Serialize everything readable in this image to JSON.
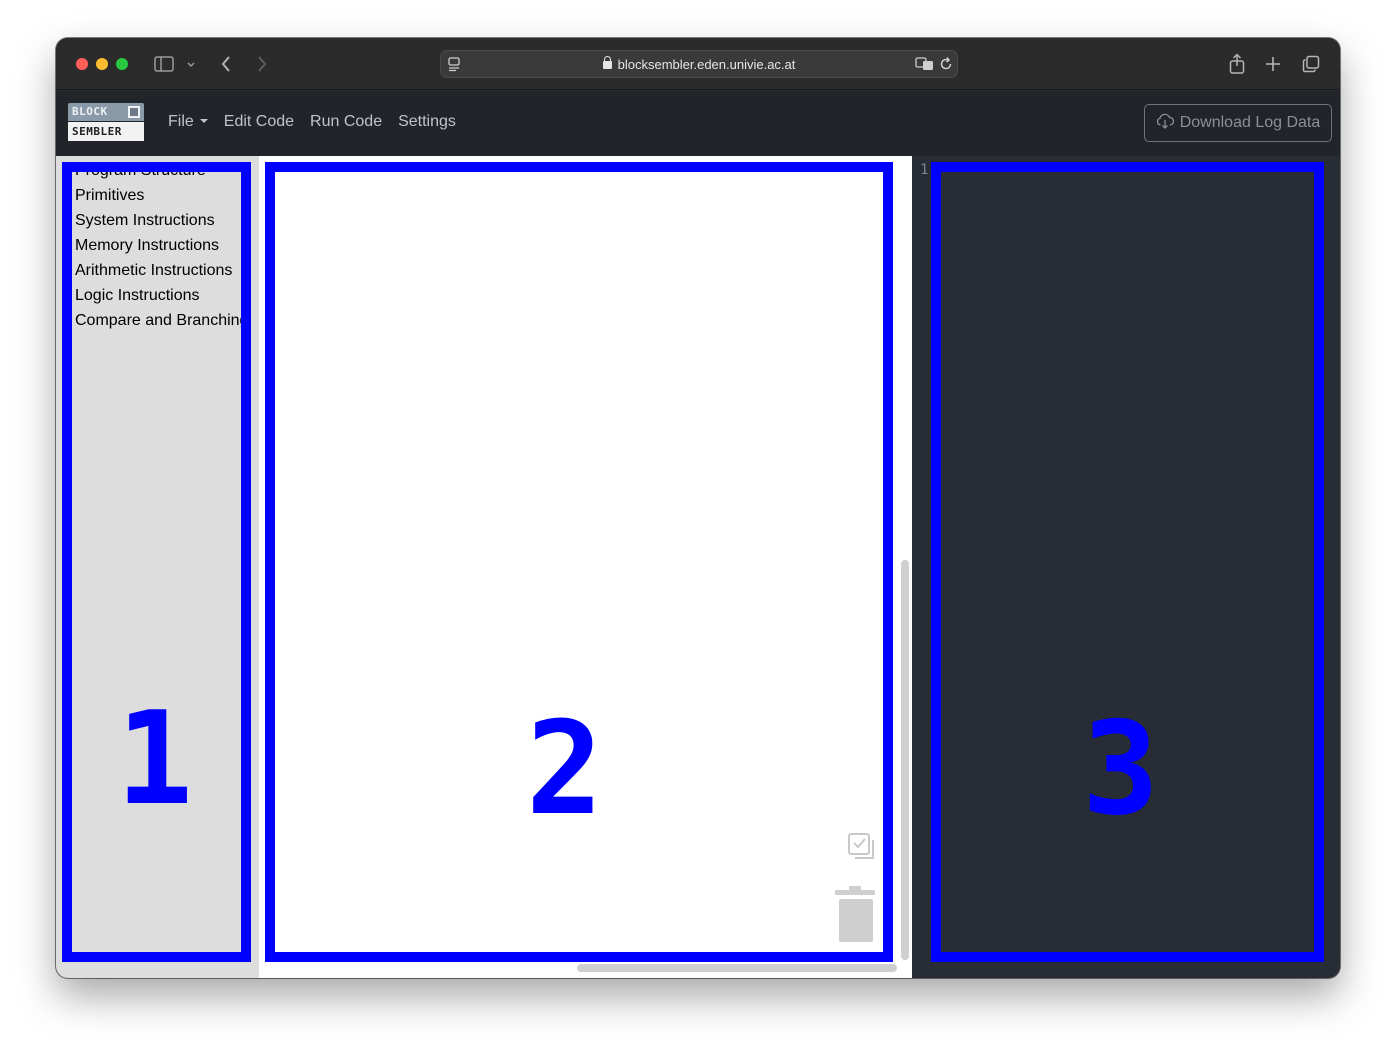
{
  "browser": {
    "url": "blocksembler.eden.univie.ac.at",
    "icons": [
      "sidebar-icon",
      "chevron-down-icon",
      "back-icon",
      "forward-icon",
      "page-settings-icon",
      "lock-icon",
      "translate-icon",
      "reload-icon",
      "share-icon",
      "plus-icon",
      "tabs-icon"
    ]
  },
  "app": {
    "logo": {
      "top": "BLOCK",
      "bottom": "SEMBLER"
    },
    "nav": {
      "file": "File",
      "edit_code": "Edit Code",
      "run_code": "Run Code",
      "settings": "Settings"
    },
    "download_button": "Download Log Data"
  },
  "toolbox": {
    "categories": [
      "Program Structure",
      "Primitives",
      "System Instructions",
      "Memory Instructions",
      "Arithmetic Instructions",
      "Logic Instructions",
      "Compare and Branching"
    ]
  },
  "editor": {
    "line_number": "1"
  },
  "annotations": {
    "labels": [
      "1",
      "2",
      "3"
    ],
    "color": "#0000ff"
  }
}
